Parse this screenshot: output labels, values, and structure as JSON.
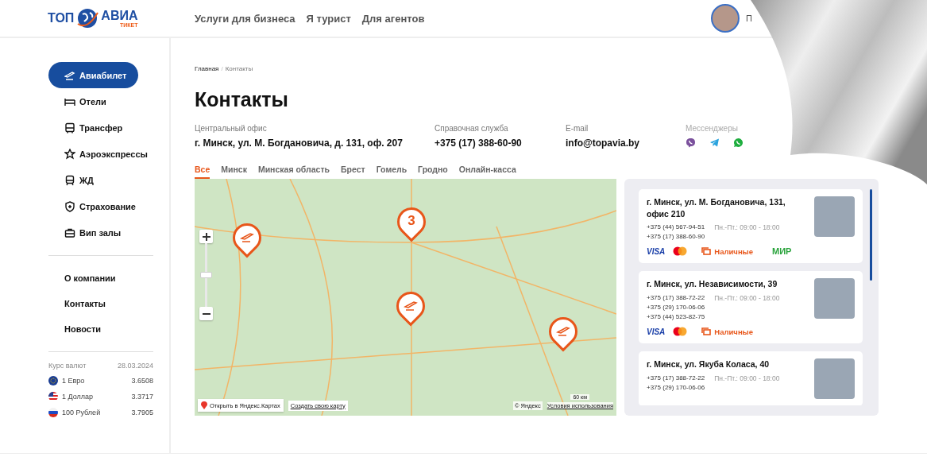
{
  "header": {
    "logo": {
      "left": "ТОП",
      "right": "АВИА",
      "sub": "ТИКЕТ"
    },
    "nav": [
      "Услуги для бизнеса",
      "Я турист",
      "Для агентов"
    ],
    "user_label": "П"
  },
  "sidebar": {
    "services": [
      {
        "label": "Авиабилет",
        "selected": true
      },
      {
        "label": "Отели",
        "selected": false
      },
      {
        "label": "Трансфер",
        "selected": false
      },
      {
        "label": "Аэроэкспрессы",
        "selected": false
      },
      {
        "label": "ЖД",
        "selected": false
      },
      {
        "label": "Страхование",
        "selected": false
      },
      {
        "label": "Вип залы",
        "selected": false
      }
    ],
    "links": [
      "О компании",
      "Контакты",
      "Новости"
    ],
    "currency": {
      "title": "Курс валют",
      "date": "28.03.2024",
      "rates": [
        {
          "label": "1 Евро",
          "value": "3.6508"
        },
        {
          "label": "1 Доллар",
          "value": "3.3717"
        },
        {
          "label": "100 Рублей",
          "value": "3.7905"
        }
      ]
    }
  },
  "breadcrumbs": {
    "items": [
      "Главная",
      "Контакты"
    ],
    "separator": "/"
  },
  "title": "Контакты",
  "info": [
    {
      "label": "Центральный офис",
      "value": "г. Минск, ул. М. Богдановича, д. 131, оф. 207"
    },
    {
      "label": "Справочная служба",
      "value": "+375 (17) 388-60-90"
    },
    {
      "label": "E-mail",
      "value": "info@topavia.by"
    }
  ],
  "messengers": {
    "label": "Мессенджеры"
  },
  "tabs": [
    {
      "label": "Все",
      "selected": true
    },
    {
      "label": "Минск",
      "selected": false
    },
    {
      "label": "Минская область",
      "selected": false
    },
    {
      "label": "Брест",
      "selected": false
    },
    {
      "label": "Гомель",
      "selected": false
    },
    {
      "label": "Гродно",
      "selected": false
    },
    {
      "label": "Онлайн-касса",
      "selected": false
    }
  ],
  "map": {
    "zoom": {
      "level": 0.5
    },
    "markers": [
      {
        "kind": "cluster",
        "count": "3"
      },
      {
        "kind": "office"
      },
      {
        "kind": "office"
      },
      {
        "kind": "office"
      }
    ],
    "open_link": "Открыть в Яндекс.Картах",
    "create_link": "Создать свою карту",
    "scale": "60 км",
    "copyright": "© Яндекс",
    "terms": "Условия использования"
  },
  "offices": [
    {
      "address": "г. Минск, ул. М. Богдановича, 131, офис 210",
      "phones": [
        "+375 (44) 567-94-51",
        "+375 (17) 388-60-90"
      ],
      "hours": "Пн.-Пт.: 09:00 - 18:00",
      "payments": [
        {
          "kind": "visa",
          "label": "VISA"
        },
        {
          "kind": "mastercard"
        },
        {
          "kind": "cash",
          "label": "Наличные"
        },
        {
          "kind": "mir",
          "label": "МИР"
        }
      ]
    },
    {
      "address": "г. Минск, ул. Независимости, 39",
      "phones": [
        "+375 (17) 388-72-22",
        "+375 (29) 170-06-06",
        "+375 (44) 523-82-75"
      ],
      "hours": "Пн.-Пт.: 09:00 - 18:00",
      "payments": [
        {
          "kind": "visa",
          "label": "VISA"
        },
        {
          "kind": "mastercard"
        },
        {
          "kind": "cash",
          "label": "Наличные"
        }
      ]
    },
    {
      "address": "г. Минск, ул. Якуба Коласа, 40",
      "phones": [
        "+375 (17) 388-72-22",
        "+375 (29) 170-06-06"
      ],
      "hours": "Пн.-Пт.: 09:00 - 18:00"
    }
  ]
}
